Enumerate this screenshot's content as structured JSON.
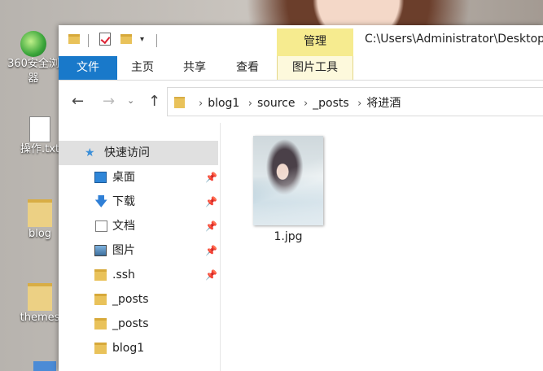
{
  "desktop": {
    "icons": [
      {
        "label_line1": "360安全浏",
        "label_line2": "器"
      },
      {
        "label": "操作.txt"
      },
      {
        "label": "blog"
      },
      {
        "label": "themes"
      }
    ]
  },
  "titlebar": {
    "contextual_tab": "管理",
    "path": "C:\\Users\\Administrator\\Desktop"
  },
  "ribbon": {
    "tabs": [
      "文件",
      "主页",
      "共享",
      "查看"
    ],
    "contextual_tools_tab": "图片工具"
  },
  "navigation": {
    "breadcrumbs": [
      "blog1",
      "source",
      "_posts",
      "将进酒"
    ]
  },
  "sidebar": {
    "quick_access": "快速访问",
    "items": [
      {
        "label": "桌面",
        "icon": "desktop-icon",
        "pinned": true
      },
      {
        "label": "下载",
        "icon": "download-icon",
        "pinned": true
      },
      {
        "label": "文档",
        "icon": "document-icon",
        "pinned": true
      },
      {
        "label": "图片",
        "icon": "pictures-icon",
        "pinned": true
      },
      {
        "label": ".ssh",
        "icon": "folder-icon",
        "pinned": true
      },
      {
        "label": "_posts",
        "icon": "folder-icon",
        "pinned": false
      },
      {
        "label": "_posts",
        "icon": "folder-icon",
        "pinned": false
      },
      {
        "label": "blog1",
        "icon": "folder-icon",
        "pinned": false
      }
    ]
  },
  "content": {
    "files": [
      {
        "name": "1.jpg",
        "type": "image"
      }
    ]
  },
  "colors": {
    "file_tab": "#1979ca",
    "manage_tab": "#f6eb8f",
    "selection": "#e0e0e0",
    "folder": "#e9c25a"
  }
}
